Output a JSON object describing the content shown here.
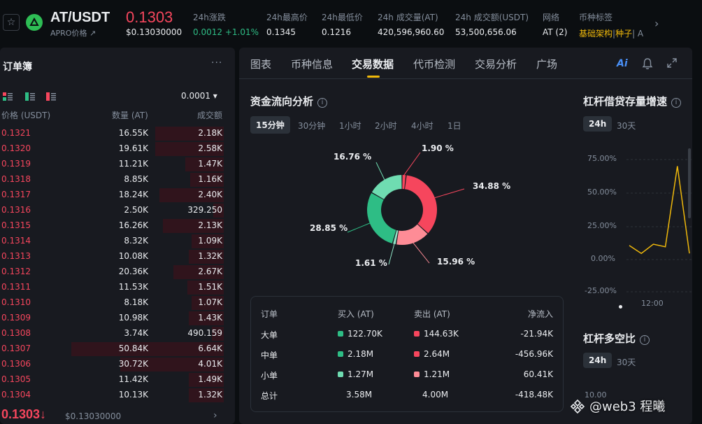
{
  "header": {
    "symbol": "AT/USDT",
    "sub_label": "APRO价格 ↗",
    "price": "0.1303",
    "price_usd": "$0.13030000",
    "stats": [
      {
        "label": "24h涨跌",
        "value_a": "0.0012",
        "value_b": "+1.01%"
      },
      {
        "label": "24h最高价",
        "value": "0.1345"
      },
      {
        "label": "24h最低价",
        "value": "0.1216"
      },
      {
        "label": "24h 成交量(AT)",
        "value": "420,596,960.60"
      },
      {
        "label": "24h 成交额(USDT)",
        "value": "53,500,656.06"
      },
      {
        "label": "网络",
        "value": "AT (2)"
      },
      {
        "label": "币种标签",
        "tag1": "基础架构",
        "sep": "|",
        "tag2": "种子",
        "tag3": "| A"
      }
    ]
  },
  "orderbook": {
    "title": "订单簿",
    "more": "···",
    "tick": "0.0001 ▾",
    "col_price": "价格 (USDT)",
    "col_qty": "数量 (AT)",
    "col_amt": "成交额",
    "rows": [
      {
        "price": "0.1321",
        "qty": "16.55K",
        "amt": "2.18K",
        "depth": 0.45
      },
      {
        "price": "0.1320",
        "qty": "19.61K",
        "amt": "2.58K",
        "depth": 0.45
      },
      {
        "price": "0.1319",
        "qty": "11.21K",
        "amt": "1.47K",
        "depth": 0.25
      },
      {
        "price": "0.1318",
        "qty": "8.85K",
        "amt": "1.16K",
        "depth": 0.22
      },
      {
        "price": "0.1317",
        "qty": "18.24K",
        "amt": "2.40K",
        "depth": 0.42
      },
      {
        "price": "0.1316",
        "qty": "2.50K",
        "amt": "329.250",
        "depth": 0.07
      },
      {
        "price": "0.1315",
        "qty": "16.26K",
        "amt": "2.13K",
        "depth": 0.4
      },
      {
        "price": "0.1314",
        "qty": "8.32K",
        "amt": "1.09K",
        "depth": 0.21
      },
      {
        "price": "0.1313",
        "qty": "10.08K",
        "amt": "1.32K",
        "depth": 0.23
      },
      {
        "price": "0.1312",
        "qty": "20.36K",
        "amt": "2.67K",
        "depth": 0.33
      },
      {
        "price": "0.1311",
        "qty": "11.53K",
        "amt": "1.51K",
        "depth": 0.24
      },
      {
        "price": "0.1310",
        "qty": "8.18K",
        "amt": "1.07K",
        "depth": 0.21
      },
      {
        "price": "0.1309",
        "qty": "10.98K",
        "amt": "1.43K",
        "depth": 0.23
      },
      {
        "price": "0.1308",
        "qty": "3.74K",
        "amt": "490.159",
        "depth": 0.08
      },
      {
        "price": "0.1307",
        "qty": "50.84K",
        "amt": "6.64K",
        "depth": 1.0
      },
      {
        "price": "0.1306",
        "qty": "30.72K",
        "amt": "4.01K",
        "depth": 0.68
      },
      {
        "price": "0.1305",
        "qty": "11.42K",
        "amt": "1.49K",
        "depth": 0.23
      },
      {
        "price": "0.1304",
        "qty": "10.13K",
        "amt": "1.32K",
        "depth": 0.23
      }
    ],
    "last_price": "0.1303↓",
    "last_price_usd": "$0.13030000",
    "chevron": "›"
  },
  "tabs": [
    "图表",
    "币种信息",
    "交易数据",
    "代币检测",
    "交易分析",
    "广场"
  ],
  "active_tab": 2,
  "ai_label": "Ai",
  "flow": {
    "title": "资金流向分析",
    "intervals": [
      "15分钟",
      "30分钟",
      "1小时",
      "2小时",
      "4小时",
      "1日"
    ],
    "active_interval": 0,
    "slices": [
      {
        "label": "1.90 %",
        "value": 1.9,
        "color": "#f6465d"
      },
      {
        "label": "34.88 %",
        "value": 34.88,
        "color": "#f6465d"
      },
      {
        "label": "15.96 %",
        "value": 15.96,
        "color": "#fe8c96"
      },
      {
        "label": "1.61 %",
        "value": 1.61,
        "color": "#8fe3c5"
      },
      {
        "label": "28.85 %",
        "value": 28.85,
        "color": "#2ebd85"
      },
      {
        "label": "16.76 %",
        "value": 16.76,
        "color": "#6fdcb1"
      }
    ],
    "table": {
      "headers": [
        "订单",
        "买入 (AT)",
        "卖出 (AT)",
        "净流入"
      ],
      "rows": [
        {
          "type": "大单",
          "buy": "122.70K",
          "sell": "144.63K",
          "net": "-21.94K",
          "buy_color": "#2ebd85",
          "sell_color": "#f6465d"
        },
        {
          "type": "中单",
          "buy": "2.18M",
          "sell": "2.64M",
          "net": "-456.96K",
          "buy_color": "#2ebd85",
          "sell_color": "#f6465d"
        },
        {
          "type": "小单",
          "buy": "1.27M",
          "sell": "1.21M",
          "net": "60.41K",
          "buy_color": "#6fdcb1",
          "sell_color": "#fe8c96"
        },
        {
          "type": "总计",
          "buy": "3.58M",
          "sell": "4.00M",
          "net": "-418.48K"
        }
      ]
    }
  },
  "leverage": {
    "title": "杠杆借贷存量增速",
    "periods": [
      "24h",
      "30天"
    ],
    "y_ticks": [
      "75.00%",
      "50.00%",
      "25.00%",
      "0.00%",
      "-25.00%"
    ],
    "x_tick": "12:00",
    "title2": "杠杆多空比",
    "y_tick2": "10.00",
    "line_color": "#f0b90b"
  },
  "chart_data": {
    "type": "line",
    "title": "杠杆借贷存量增速",
    "y_ticks": [
      "75.00%",
      "50.00%",
      "25.00%",
      "0.00%",
      "-25.00%"
    ],
    "ylim": [
      -25,
      75
    ],
    "x_ticks": [
      "12:00"
    ],
    "series": [
      {
        "values": [
          10,
          4,
          11,
          9,
          70,
          4
        ]
      }
    ]
  },
  "watermark": "@web3  程曦"
}
